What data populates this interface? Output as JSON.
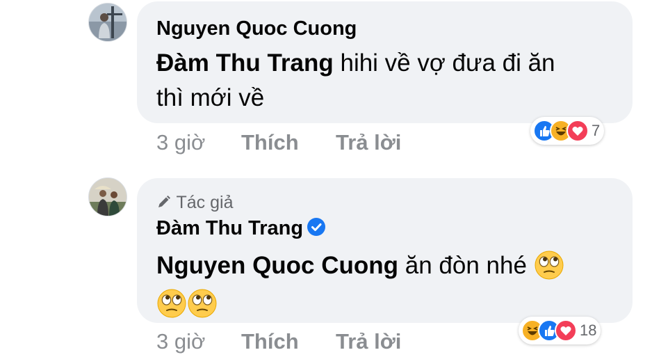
{
  "comments": [
    {
      "author": "Nguyen Quoc Cuong",
      "mention": "Đàm Thu Trang",
      "text_line1": " hihi về vợ đưa đi ăn",
      "text_line2": "thì mới về",
      "time": "3 giờ",
      "like_label": "Thích",
      "reply_label": "Trả lời",
      "reaction_icons": [
        "like-icon",
        "haha-icon",
        "love-icon"
      ],
      "reaction_count": "7"
    },
    {
      "author_tag": "Tác giả",
      "author": "Đàm Thu Trang",
      "verified": true,
      "mention": "Nguyen Quoc Cuong",
      "text": " ăn đòn nhé ",
      "emoji": "rolling-eyes-icon",
      "time": "3 giờ",
      "like_label": "Thích",
      "reply_label": "Trả lời",
      "reaction_icons": [
        "haha-icon",
        "like-icon",
        "love-icon"
      ],
      "reaction_count": "18"
    }
  ],
  "colors": {
    "bubble": "#f0f2f5",
    "meta_text": "#8a8d91",
    "like": "#1877f2",
    "haha": "#f7b125",
    "love": "#f33e58"
  }
}
